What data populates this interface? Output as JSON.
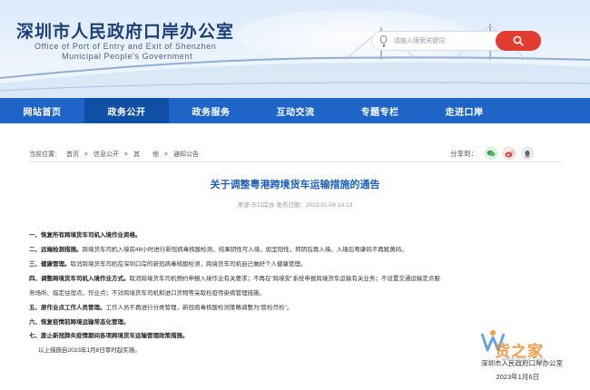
{
  "header": {
    "title": "深圳市人民政府口岸办公室",
    "subtitle_line1": "Office of Port of Entry and Exit of Shenzhen",
    "subtitle_line2": "Municipal People's Government",
    "search_placeholder": "请输入搜索关键词"
  },
  "nav": {
    "items": [
      "网站首页",
      "政务公开",
      "政务服务",
      "互动交流",
      "专题专栏",
      "走进口岸"
    ],
    "active": "政务公开"
  },
  "breadcrumb": {
    "prefix": "当前位置：",
    "items": [
      "首页",
      ">",
      "信息公开",
      ">",
      "其　　他",
      ">",
      "通知公告"
    ]
  },
  "share": {
    "label": "分享到："
  },
  "article": {
    "title": "关于调整粤港跨境货车运输措施的通告",
    "meta": "来源:市口岸办  发布日期：2023-01-06 14:13",
    "paragraphs": [
      {
        "bold": "一、恢复所有跨境货车司机入境作业资格。",
        "text": ""
      },
      {
        "bold": "二、远端检测措施。",
        "text": "跨境货车司机入境前48小时进行新冠病毒核酸检测，结果阴性可入境，如呈阳性，转阴后再入境。入境后粤康码不再赋黄码。"
      },
      {
        "bold": "三、健康管理。",
        "text": "取消跨境货车司机在深圳口岸的新冠病毒核酸检测，跨境货车司机自己做好个人健康管理。"
      },
      {
        "bold": "四、调整跨境货车司机入境作业方式。",
        "text": "取消跨境货车司机预约申报入境作业有关要求；不再在“跨境安”系统申报跨境货车运输有关业务；不设置交通运输定点服"
      },
      {
        "bold": "",
        "text": "务场所、指定住宿点、作业点；不对跨境货车司机和进口货物等采取检疫传染病管理措施。"
      },
      {
        "bold": "五、原作业点工作人员管理。",
        "text": "工作人员不再进行分类管理，新冠病毒核酸检测策略调整为“愿检尽检”。"
      },
      {
        "bold": "六、恢复疫情前跨境运输常态化管理。",
        "text": ""
      },
      {
        "bold": "七、废止新冠肺炎疫情期间各项跨境货车运输管理政策措施。",
        "text": ""
      },
      {
        "bold": "",
        "text": "以上措施自2023年1月8日零时起实施。"
      }
    ],
    "signature": "深圳市人民政府口岸办公室",
    "date": "2023年1月6日"
  },
  "watermark": {
    "text": "货之家",
    "url": "www.hzjcc.com"
  },
  "colors": {
    "nav_bg": "#1f65c8",
    "nav_active": "#114ea6",
    "title_blue": "#1d5fbf",
    "search_red": "#e23b32"
  }
}
